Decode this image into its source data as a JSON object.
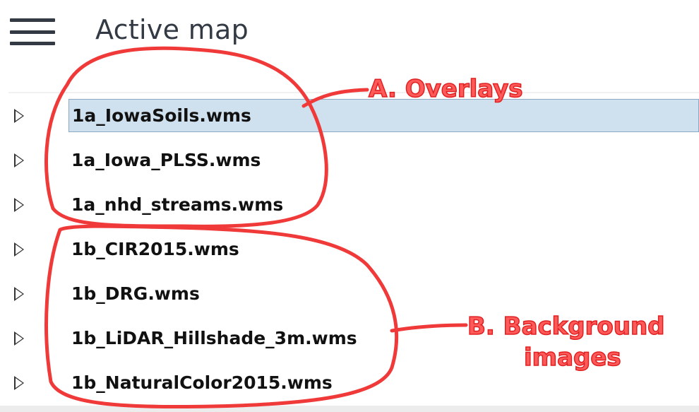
{
  "header": {
    "title": "Active map"
  },
  "layers": [
    {
      "name": "1a_IowaSoils.wms",
      "selected": true
    },
    {
      "name": "1a_Iowa_PLSS.wms"
    },
    {
      "name": "1a_nhd_streams.wms"
    },
    {
      "name": "1b_CIR2015.wms"
    },
    {
      "name": "1b_DRG.wms"
    },
    {
      "name": "1b_LiDAR_Hillshade_3m.wms"
    },
    {
      "name": "1b_NaturalColor2015.wms"
    }
  ],
  "annotations": {
    "overlays": "A. Overlays",
    "background_line1": "B. Background",
    "background_line2": "images",
    "color": "#f03a3a"
  }
}
